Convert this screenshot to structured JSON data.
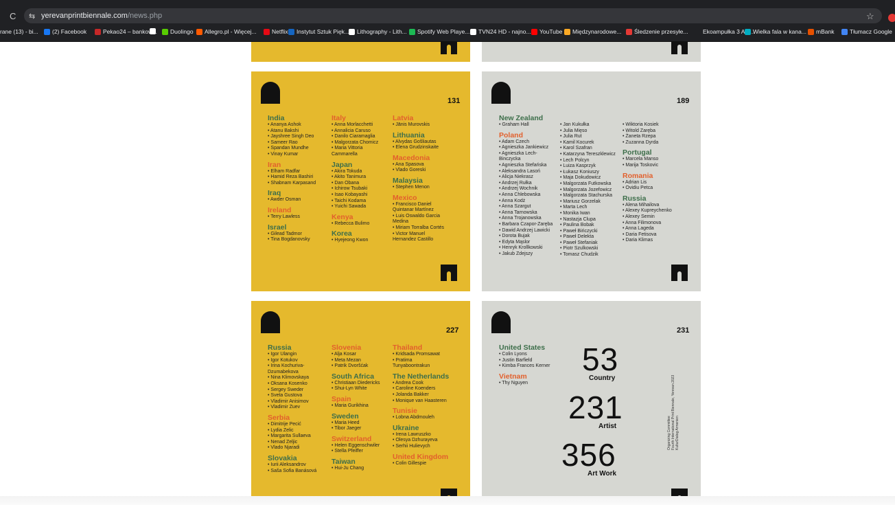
{
  "browser": {
    "url_host": "yerevanprintbiennale.com",
    "url_path": "/news.php",
    "bookmarks": [
      {
        "label": "rane (13) - bi...",
        "color": "#8a8a8a"
      },
      {
        "label": "(2) Facebook",
        "color": "#1877f2"
      },
      {
        "label": "Pekao24 – bankow...",
        "color": "#c62828"
      },
      {
        "label": "",
        "color": "#ffffff"
      },
      {
        "label": "Duolingo",
        "color": "#58cc02"
      },
      {
        "label": "Allegro.pl - Więcej...",
        "color": "#ff5a00"
      },
      {
        "label": "Netflix",
        "color": "#e50914"
      },
      {
        "label": "Instytut Sztuk Pięk...",
        "color": "#1565c0"
      },
      {
        "label": "Lithography - Lith...",
        "color": "#ffffff"
      },
      {
        "label": "Spotify Web Playe...",
        "color": "#1db954"
      },
      {
        "label": "TVN24 HD - najno...",
        "color": "#ffffff"
      },
      {
        "label": "YouTube",
        "color": "#ff0000"
      },
      {
        "label": "Międzynarodowe...",
        "color": "#f9a825"
      },
      {
        "label": "Śledzenie przesyłe...",
        "color": "#e53935"
      },
      {
        "label": "Ekoampułka 3 Ant...",
        "color": "#202124"
      },
      {
        "label": "Wielka fala w kana...",
        "color": "#00acc1"
      },
      {
        "label": "mBank",
        "color": "#e65100"
      },
      {
        "label": "Tłumacz Google",
        "color": "#4285f4"
      }
    ]
  },
  "colors": {
    "yellow": "#e5b92d",
    "grey": "#d6d7d2",
    "green": "#3d6e4a",
    "orange": "#e2602d"
  },
  "cards": {
    "p131": {
      "page": "131",
      "col1": [
        {
          "h": "India",
          "c": "g",
          "items": [
            "• Ananya Ashok",
            "• Atanu Bakshi",
            "• Jayshree Singh Deo",
            "• Sameer Rao",
            "• Spandan Mundhe",
            "• Vinay Kumar"
          ]
        },
        {
          "h": "Iran",
          "c": "r",
          "items": [
            "• Elham Radfar",
            "• Hamid Reza Bashiri",
            "• Shabnam Karpasand"
          ]
        },
        {
          "h": "Iraq",
          "c": "g",
          "items": [
            "• Awder Osman"
          ]
        },
        {
          "h": "Ireland",
          "c": "r",
          "items": [
            "• Terry Lawless"
          ]
        },
        {
          "h": "Israel",
          "c": "g",
          "items": [
            "• Gilead Tadmor",
            "• Tina Bogdanovsky"
          ]
        }
      ],
      "col2": [
        {
          "h": "Italy",
          "c": "r",
          "items": [
            "• Anna Morlacchetti",
            "• Annalicia Caruso",
            "• Danilo Ciaramaglia",
            "• Malgorzata Chomicz",
            "• Maria Vittoria",
            "  Cammarella"
          ]
        },
        {
          "h": "Japan",
          "c": "g",
          "items": [
            "• Akira Tokuda",
            "• Akito Tanimura",
            "• Dan Obana",
            "• Ichirow Tsubaki",
            "• Isao Kobayashi",
            "• Taichi Kodama",
            "• Yuichi Sawada"
          ]
        },
        {
          "h": "Kenya",
          "c": "r",
          "items": [
            "• Rebecca Bulimo"
          ]
        },
        {
          "h": "Korea",
          "c": "g",
          "items": [
            "• Hyejeong Kwon"
          ]
        }
      ],
      "col3": [
        {
          "h": "Latvia",
          "c": "r",
          "items": [
            "• Jānis Murovskis"
          ]
        },
        {
          "h": "Lithuania",
          "c": "g",
          "items": [
            "• Alvydas Gošliautas",
            "• Elena Grudzinskaite"
          ]
        },
        {
          "h": "Macedonia",
          "c": "r",
          "items": [
            "• Ana Spasova",
            "• Vlado Goreski"
          ]
        },
        {
          "h": "Malaysia",
          "c": "g",
          "items": [
            "• Stephen Menon"
          ]
        },
        {
          "h": "Mexico",
          "c": "r",
          "items": [
            "• Francisco Daniel",
            "  Quintanar Martínez",
            "• Luis Oswaldo Garcia",
            "  Medina",
            "• Miriam Torralba Cortés",
            "• Victor Manuel",
            "  Hernandez Castillo"
          ]
        }
      ]
    },
    "p189": {
      "page": "189",
      "col1": [
        {
          "h": "New Zealand",
          "c": "g",
          "items": [
            "• Graham Hall"
          ]
        },
        {
          "h": "Poland",
          "c": "r",
          "items": [
            "• Adam Czech",
            "• Agnieszka Jankiewicz",
            "• Agnieszka Lech-",
            "  Binczycka",
            "• Agnieszka Stefańska",
            "• Aleksandra Lasoń",
            "• Alicja Niekrasz",
            "• Andrzej Rułka",
            "• Andrzej Wochnik",
            "• Anna Chlebowska",
            "• Anna Kodż",
            "• Anna Szargut",
            "• Anna Tarnowska",
            "• Anna Trojanowska",
            "• Barbara Czapor-Zaręba",
            "• Dawid Andrzej Lawicki",
            "• Dorota Bujak",
            "• Edyta Mąslor",
            "• Henryk Krollkowski",
            "• Jakub Zdejszy"
          ]
        }
      ],
      "col2": [
        {
          "h": "",
          "c": "g",
          "items": [
            "• Jan Kukułka",
            "• Julia Mięso",
            "• Julia Rut",
            "• Kamil Kocurek",
            "• Karol Szafran",
            "• Katarzyna Tereszklewicz",
            "• Lech Polcyn",
            "• Luiza Kasprzyk",
            "• Łukasz Koniuszy",
            "• Maja Dokudowicz",
            "• Malgorzata Futkowska",
            "• Malgorzata Jozefowicz",
            "• Malgorzata Stachurska",
            "• Mariusz Gorzelak",
            "• Marta Lech",
            "• Monika Iwan",
            "• Nastazja Clupa",
            "• Paulina Bobak",
            "• Paweł Bińczycki",
            "• Paweł Delekta",
            "• Paweł Stefaniak",
            "• Piotr Szulkowski",
            "• Tomasz Chudzik"
          ]
        }
      ],
      "col3": [
        {
          "h": "",
          "c": "g",
          "items": [
            "• Wiktoria Kosiek",
            "• Witold Zaręba",
            "• Żaneta Rzepa",
            "• Zuzanna Dyrda"
          ]
        },
        {
          "h": "Portugal",
          "c": "g",
          "items": [
            "• Marcela Manso",
            "• Marija Toskovic"
          ]
        },
        {
          "h": "Romania",
          "c": "r",
          "items": [
            "• Adrian Lis",
            "• Ovidiu Petca"
          ]
        },
        {
          "h": "Russia",
          "c": "g",
          "items": [
            "• Alena Mihailova",
            "• Alexey Kuprеychenko",
            "• Alexey Semin",
            "• Anna Filimonova",
            "• Anna Lageda",
            "• Daria Fetisova",
            "• Daria Klimas"
          ]
        }
      ]
    },
    "p227": {
      "page": "227",
      "col1": [
        {
          "h": "Russia",
          "c": "g",
          "items": [
            "• Igor Ulangin",
            "• Igor Kotukov",
            "• Irina Kochuriva-",
            "  Dzumabekova",
            "• Nina Klimovskaya",
            "• Oksana Kosenko",
            "• Sergey Sweder",
            "• Sveta Gustova",
            "• Vladimir Anisimov",
            "• Vladimir Zuev"
          ]
        },
        {
          "h": "Serbia",
          "c": "r",
          "items": [
            "• Dimitrije Pecić",
            "• Lydia Zelic",
            "• Margarita Sullaeva",
            "• Nenad Zeljic",
            "• Vlado Njaradi"
          ]
        },
        {
          "h": "Slovakia",
          "c": "g",
          "items": [
            "• Iurii Aleksandrov",
            "• Saša Sofia Banásová"
          ]
        }
      ],
      "col2": [
        {
          "h": "Slovenia",
          "c": "r",
          "items": [
            "• Alja Kosar",
            "• Meta Mezan",
            "• Patrik Dvoršćak"
          ]
        },
        {
          "h": "South Africa",
          "c": "g",
          "items": [
            "• Christiaan Diedericks",
            "• Shui-Lyn White"
          ]
        },
        {
          "h": "Spain",
          "c": "r",
          "items": [
            "• Maria Gurikhina"
          ]
        },
        {
          "h": "Sweden",
          "c": "g",
          "items": [
            "• Maria Heed",
            "• Tibor Jaeger"
          ]
        },
        {
          "h": "Switzerland",
          "c": "r",
          "items": [
            "• Helen Eggenschwiler",
            "• Stella Pfeiffer"
          ]
        },
        {
          "h": "Taiwan",
          "c": "g",
          "items": [
            "• Hui-Ju Chang"
          ]
        }
      ],
      "col3": [
        {
          "h": "Thailand",
          "c": "r",
          "items": [
            "• Kridsada Promsawat",
            "• Pratima",
            "  Tunyaboontrakun"
          ]
        },
        {
          "h": "The Netherlands",
          "c": "g",
          "items": [
            "• Andrea Cook",
            "• Caroline Koenders",
            "• Jolanda Bakker",
            "• Monique van Haasteren"
          ]
        },
        {
          "h": "Tunisie",
          "c": "r",
          "items": [
            "• Lobna Abdmouleh"
          ]
        },
        {
          "h": "Ukraine",
          "c": "g",
          "items": [
            "• Irena Lawruszko",
            "• Olesya Dzhurayeva",
            "• Serhii Hulievych"
          ]
        },
        {
          "h": "United Kingdom",
          "c": "r",
          "items": [
            "• Colin Gillespie"
          ]
        }
      ]
    },
    "p231": {
      "page": "231",
      "col1": [
        {
          "h": "United States",
          "c": "g",
          "items": [
            "• Colin Lyons",
            "• Justin Barfield",
            "• Kimba Frances Kerner"
          ]
        },
        {
          "h": "Vietnam",
          "c": "r",
          "items": [
            "• Thy Nguyen"
          ]
        }
      ],
      "stats": [
        {
          "num": "53",
          "label": "Country"
        },
        {
          "num": "231",
          "label": "Artist"
        },
        {
          "num": "356",
          "label": "Art Work"
        }
      ],
      "vertical_lines": [
        "Organizing Committee",
        "Fourth International Print Biennale, Yerevan 2023",
        "KulturDialog Armenien"
      ]
    }
  }
}
